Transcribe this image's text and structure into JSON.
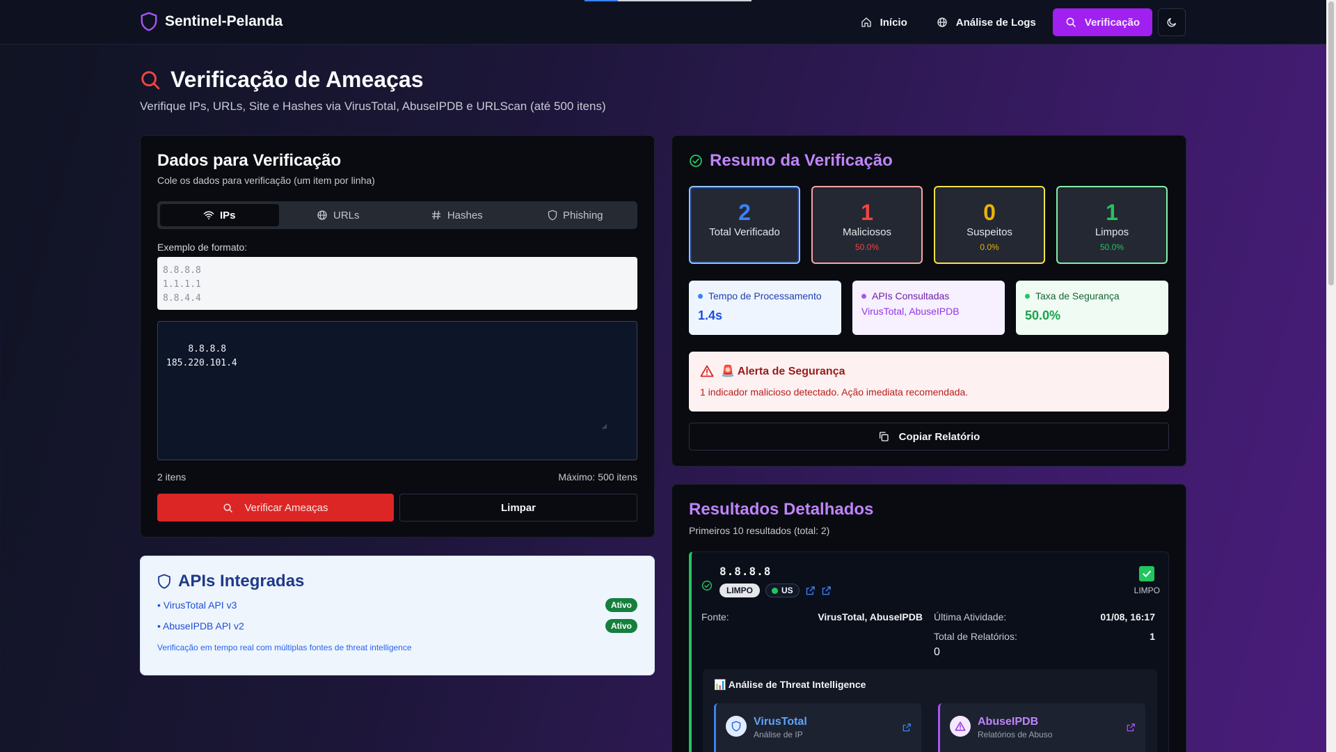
{
  "app": {
    "name": "Sentinel-Pelanda"
  },
  "nav": {
    "items": [
      {
        "label": "Início",
        "icon": "home-icon"
      },
      {
        "label": "Análise de Logs",
        "icon": "globe-icon"
      },
      {
        "label": "Verificação",
        "icon": "search-icon",
        "active": true
      }
    ],
    "theme_icon": "moon-icon"
  },
  "header": {
    "title": "Verificação de Ameaças",
    "subtitle": "Verifique IPs, URLs, Site e Hashes via VirusTotal, AbuseIPDB e URLScan (até 500 itens)"
  },
  "input_card": {
    "title": "Dados para Verificação",
    "description": "Cole os dados para verificação (um item por linha)",
    "tabs": [
      {
        "label": "IPs",
        "icon": "wifi-icon",
        "active": true
      },
      {
        "label": "URLs",
        "icon": "globe-icon"
      },
      {
        "label": "Hashes",
        "icon": "hash-icon"
      },
      {
        "label": "Phishing",
        "icon": "shield-icon"
      }
    ],
    "example_label": "Exemplo de formato:",
    "example": "8.8.8.8\n1.1.1.1\n8.8.4.4",
    "value": "8.8.8.8\n185.220.101.4",
    "count": "2 itens",
    "max": "Máximo: 500 itens",
    "verify_label": "Verificar Ameaças",
    "clear_label": "Limpar"
  },
  "apis": {
    "title": "APIs Integradas",
    "items": [
      {
        "name": "• VirusTotal API v3",
        "status": "Ativo"
      },
      {
        "name": "• AbuseIPDB API v2",
        "status": "Ativo"
      }
    ],
    "note": "Verificação em tempo real com múltiplas fontes de threat intelligence"
  },
  "summary": {
    "title": "Resumo da Verificação",
    "stats": [
      {
        "value": "2",
        "label": "Total Verificado",
        "pct": ""
      },
      {
        "value": "1",
        "label": "Maliciosos",
        "pct": "50.0%"
      },
      {
        "value": "0",
        "label": "Suspeitos",
        "pct": "0.0%"
      },
      {
        "value": "1",
        "label": "Limpos",
        "pct": "50.0%"
      }
    ],
    "infos": [
      {
        "label": "Tempo de Processamento",
        "value": "1.4s"
      },
      {
        "label": "APIs Consultadas",
        "value": "VirusTotal, AbuseIPDB"
      },
      {
        "label": "Taxa de Segurança",
        "value": "50.0%"
      }
    ],
    "alert": {
      "title": "🚨 Alerta de Segurança",
      "message": "1 indicador malicioso detectado. Ação imediata recomendada."
    },
    "copy_label": "Copiar Relatório"
  },
  "results": {
    "title": "Resultados Detalhados",
    "subtitle": "Primeiros 10 resultados (total: 2)",
    "items": [
      {
        "ip": "8.8.8.8",
        "badge": "LIMPO",
        "country": "US",
        "status": "LIMPO",
        "fonte_label": "Fonte:",
        "fonte": "VirusTotal, AbuseIPDB",
        "ultima_label": "Última Atividade:",
        "ultima": "01/08, 16:17",
        "relatorios_label": "Total de Relatórios:",
        "relatorios": "1",
        "relatorios_sub": "0",
        "threat_title": "📊 Análise de Threat Intelligence",
        "providers": [
          {
            "name": "VirusTotal",
            "desc": "Análise de IP"
          },
          {
            "name": "AbuseIPDB",
            "desc": "Relatórios de Abuso"
          }
        ]
      }
    ]
  },
  "colors": {
    "accent": "#a020f0",
    "danger": "#dc2626",
    "success": "#22c55e",
    "warning": "#eab308",
    "info": "#3b82f6"
  }
}
